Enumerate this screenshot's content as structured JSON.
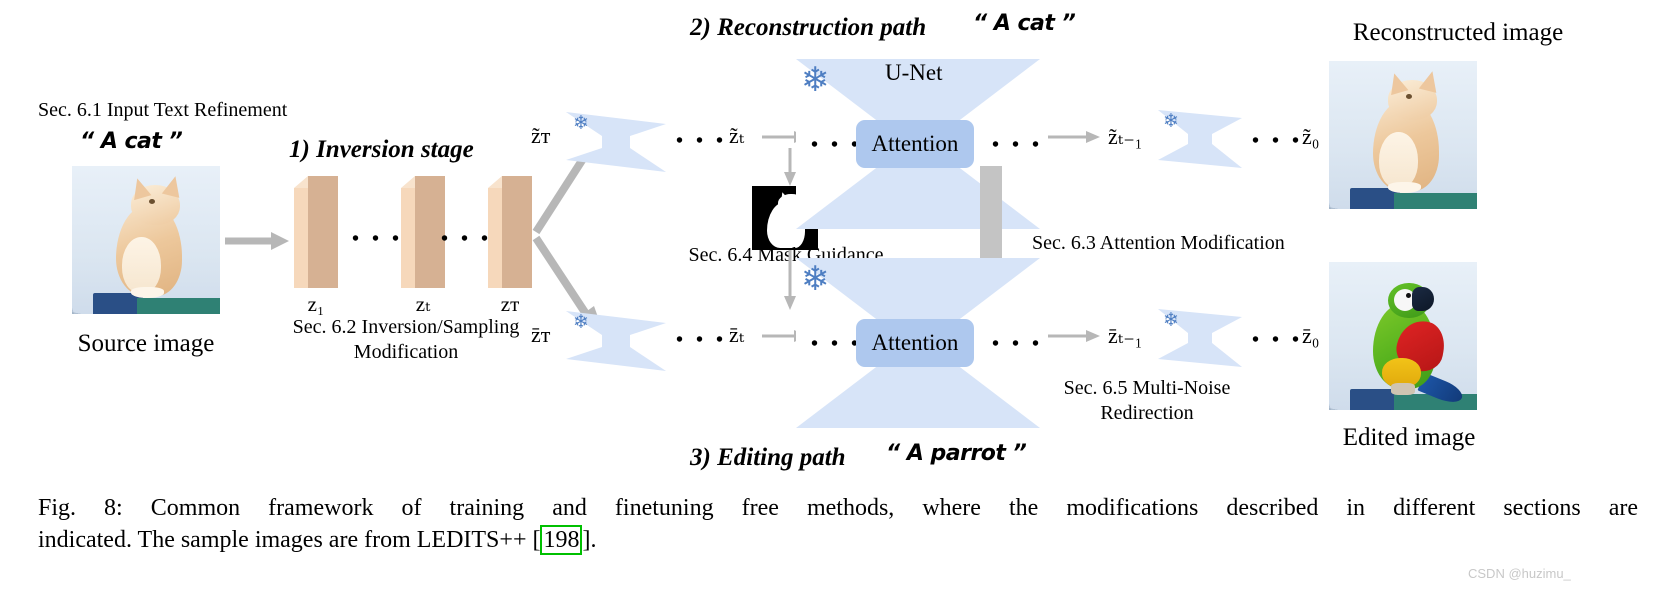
{
  "figure": {
    "caption_line1": "Fig. 8: Common framework of training and finetuning free methods, where the modifications described in different sections are",
    "caption_line2_a": "indicated. The sample images are from LEDITS++ [",
    "caption_citation": "198",
    "caption_line2_b": "].",
    "watermark": "CSDN @huzimu_"
  },
  "colors": {
    "slab_front": "#f6d8bb",
    "slab_side": "#d6b193",
    "unet_fill": "#d7e4f8",
    "attention_fill": "#aec8ee",
    "snowflake": "#4e7ec2",
    "arrow_gray": "#b7b7b7",
    "citation_box": "#00c000"
  },
  "stage1": {
    "section_label": "Sec. 6.1 Input Text Refinement",
    "prompt": "“ A cat ”",
    "source_caption": "Source image",
    "title": "1) Inversion stage",
    "slab_labels": [
      "z₁",
      "zₜ",
      "zᴛ"
    ],
    "slab_label_base": "z",
    "slab_label_subs": [
      "1",
      "t",
      "T"
    ],
    "dots": "• • •",
    "section_label_2_line1": "Sec. 6.2 Inversion/Sampling",
    "section_label_2_line2": "Modification"
  },
  "recon_path": {
    "title": "2) Reconstruction path",
    "prompt": "“ A cat ”",
    "unet_label": "U-Net",
    "latent_T": "z̃ᴛ",
    "latent_t": "z̃ₜ",
    "latent_t_minus_1": "z̃ₜ₋₁",
    "latent_0": "z̃₀",
    "attention_label": "Attention",
    "output_caption": "Reconstructed image",
    "snowflake_icon": "❄",
    "dots": "• • •"
  },
  "edit_path": {
    "title": "3) Editing path",
    "prompt": "“ A parrot ”",
    "latent_T": "z̄ᴛ",
    "latent_t": "z̄ₜ",
    "latent_t_minus_1": "z̄ₜ₋₁",
    "latent_0": "z̄₀",
    "attention_label": "Attention",
    "output_caption": "Edited image",
    "dots": "• • •"
  },
  "annotations": {
    "mask_guidance": "Sec. 6.4 Mask Guidance",
    "attention_modification": "Sec. 6.3 Attention Modification",
    "multi_noise_line1": "Sec. 6.5 Multi-Noise",
    "multi_noise_line2": "Redirection"
  }
}
